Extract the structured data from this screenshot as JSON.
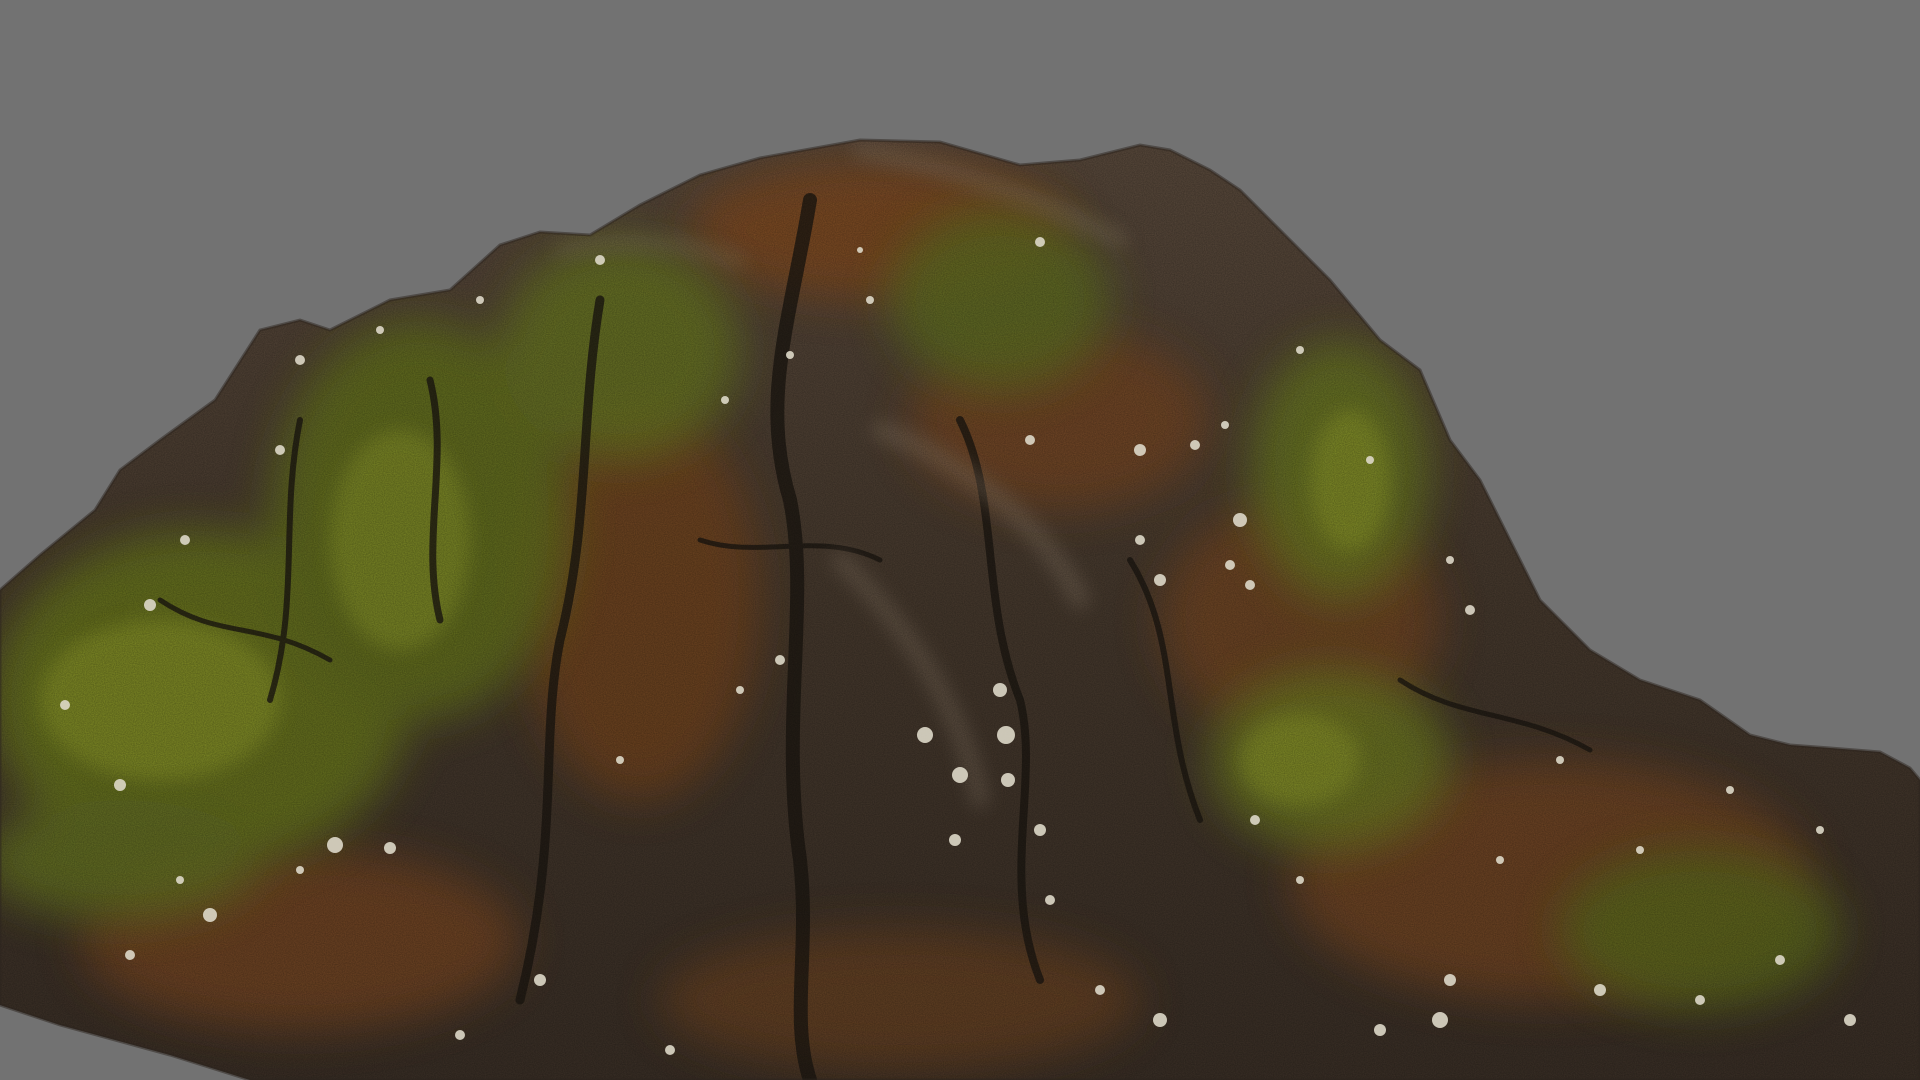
{
  "scene": {
    "subject": "mossy-rock",
    "colors": {
      "background": "#727272",
      "rock_dark": "#2e2721",
      "rock_mid": "#4a3c30",
      "rock_light": "#6a5a4c",
      "rust": "#8a4e1e",
      "moss": "#6c7a1e",
      "moss_light": "#8f9b2a",
      "lichen": "#ddd8c8"
    }
  }
}
